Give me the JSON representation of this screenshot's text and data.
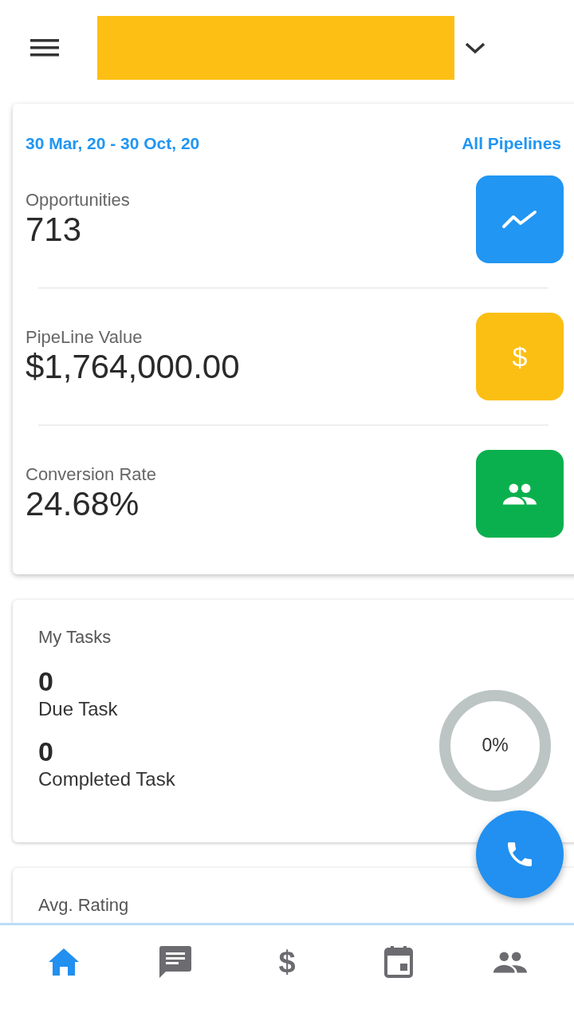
{
  "header": {
    "title_redacted": true
  },
  "summary": {
    "date_range": "30 Mar, 20 - 30 Oct, 20",
    "pipeline_filter": "All Pipelines",
    "stats": [
      {
        "label": "Opportunities",
        "value": "713",
        "kind": "chart",
        "color": "#2196f3"
      },
      {
        "label": "PipeLine Value",
        "value": "$1,764,000.00",
        "kind": "dollar",
        "icon_text": "$",
        "color": "#fbbf14"
      },
      {
        "label": "Conversion Rate",
        "value": "24.68%",
        "kind": "people",
        "color": "#0bb04e"
      }
    ]
  },
  "tasks": {
    "title": "My Tasks",
    "items": [
      {
        "count": "0",
        "label": "Due Task"
      },
      {
        "count": "0",
        "label": "Completed Task"
      }
    ],
    "progress": {
      "level": 0,
      "reading": "0%"
    }
  },
  "rating": {
    "title": "Avg. Rating"
  },
  "bottom_nav": [
    {
      "kind": "home",
      "selected": true
    },
    {
      "kind": "chat",
      "selected": false
    },
    {
      "kind": "dollar",
      "icon_text": "$",
      "selected": false
    },
    {
      "kind": "calendar",
      "selected": false
    },
    {
      "kind": "people",
      "selected": false
    }
  ]
}
